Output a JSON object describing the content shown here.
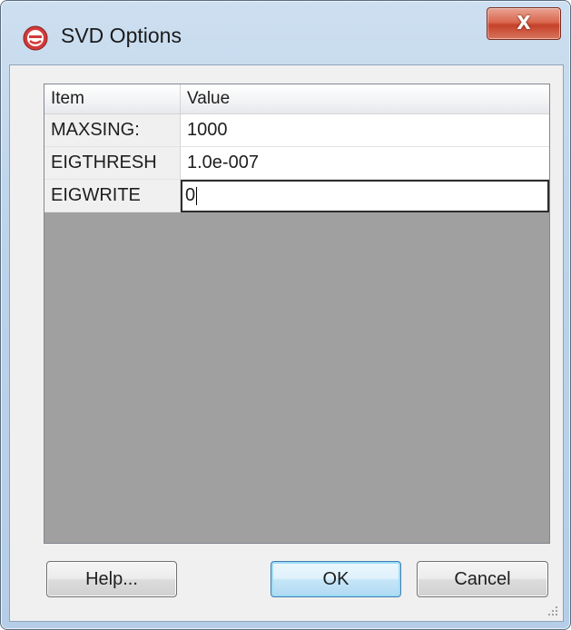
{
  "window": {
    "title": "SVD Options",
    "close_label": "X"
  },
  "grid": {
    "columns": [
      "Item",
      "Value"
    ],
    "rows": [
      {
        "item": "MAXSING:",
        "value": "1000"
      },
      {
        "item": "EIGTHRESH",
        "value": "1.0e-007"
      },
      {
        "item": "EIGWRITE",
        "value": "0"
      }
    ]
  },
  "buttons": {
    "help": "Help...",
    "ok": "OK",
    "cancel": "Cancel"
  },
  "icons": {
    "app": "app-logo-icon",
    "close": "close-icon",
    "grip": "resize-grip-icon"
  },
  "colors": {
    "accent": "#3c7fb1",
    "close": "#c5412a",
    "grid_empty": "#a0a0a0"
  }
}
